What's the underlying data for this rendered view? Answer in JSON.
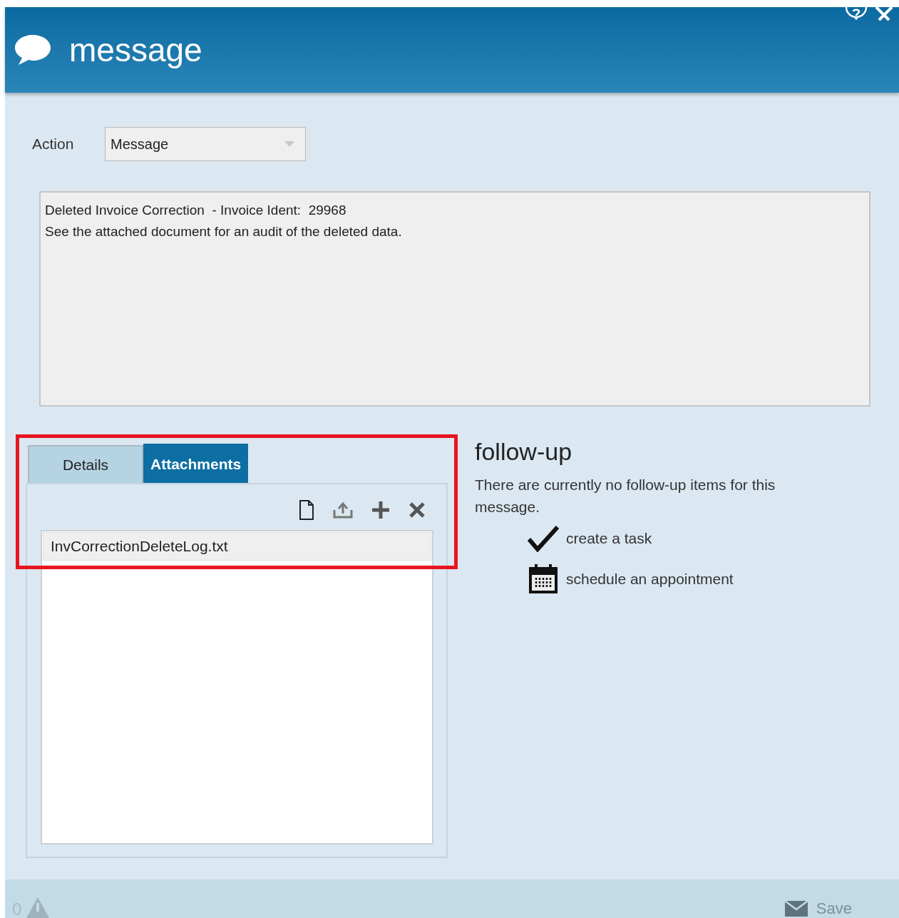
{
  "window": {
    "title": "message"
  },
  "action": {
    "label": "Action",
    "value": "Message"
  },
  "message_lines": [
    "Deleted Invoice Correction  - Invoice Ident:  29968",
    "See the attached document for an audit of the deleted data."
  ],
  "tabs": [
    {
      "label": "Details",
      "selected": false
    },
    {
      "label": "Attachments",
      "selected": true
    }
  ],
  "attachments": [
    "InvCorrectionDeleteLog.txt"
  ],
  "follow_up": {
    "title": "follow-up",
    "note": "There are currently no follow-up items for this message.",
    "items": [
      {
        "kind": "task",
        "label": "create a task"
      },
      {
        "kind": "appointment",
        "label": "schedule an appointment"
      }
    ]
  },
  "status_bar": {
    "warning_count": "0",
    "save_label": "Save"
  }
}
